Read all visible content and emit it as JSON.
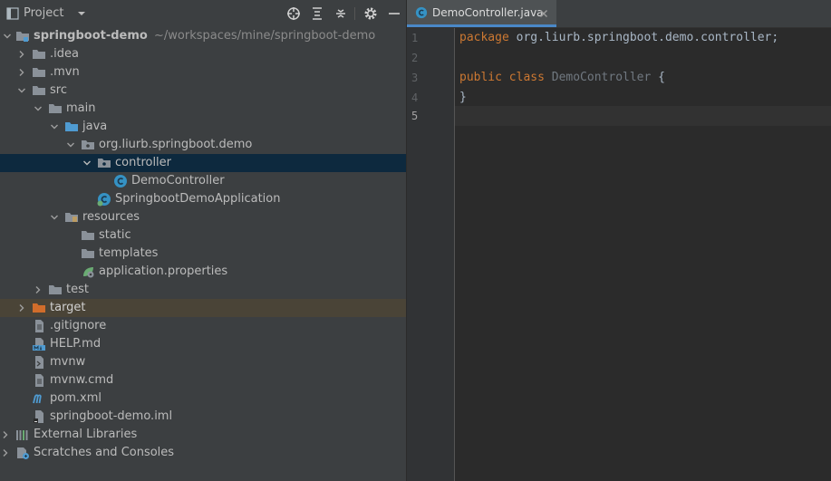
{
  "project_panel": {
    "title": "Project",
    "header_icons": [
      "locate-icon",
      "expand-all-icon",
      "collapse-all-icon",
      "gear-icon",
      "minimize-icon"
    ]
  },
  "tree": [
    {
      "label": "springboot-demo",
      "path": "~/workspaces/mine/springboot-demo",
      "icon": "module-folder-icon"
    },
    {
      "label": ".idea",
      "icon": "folder-icon"
    },
    {
      "label": ".mvn",
      "icon": "folder-icon"
    },
    {
      "label": "src",
      "icon": "folder-icon"
    },
    {
      "label": "main",
      "icon": "folder-icon"
    },
    {
      "label": "java",
      "icon": "source-folder-icon"
    },
    {
      "label": "org.liurb.springboot.demo",
      "icon": "package-icon"
    },
    {
      "label": "controller",
      "icon": "package-icon"
    },
    {
      "label": "DemoController",
      "icon": "class-icon"
    },
    {
      "label": "SpringbootDemoApplication",
      "icon": "spring-boot-class-icon"
    },
    {
      "label": "resources",
      "icon": "resources-folder-icon"
    },
    {
      "label": "static",
      "icon": "folder-icon"
    },
    {
      "label": "templates",
      "icon": "folder-icon"
    },
    {
      "label": "application.properties",
      "icon": "spring-properties-icon"
    },
    {
      "label": "test",
      "icon": "folder-icon"
    },
    {
      "label": "target",
      "icon": "excluded-folder-icon"
    },
    {
      "label": ".gitignore",
      "icon": "text-file-icon"
    },
    {
      "label": "HELP.md",
      "icon": "markdown-file-icon"
    },
    {
      "label": "mvnw",
      "icon": "shell-file-icon"
    },
    {
      "label": "mvnw.cmd",
      "icon": "text-file-icon"
    },
    {
      "label": "pom.xml",
      "icon": "maven-icon"
    },
    {
      "label": "springboot-demo.iml",
      "icon": "iml-file-icon"
    },
    {
      "label": "External Libraries",
      "icon": "libraries-icon"
    },
    {
      "label": "Scratches and Consoles",
      "icon": "scratches-icon"
    }
  ],
  "editor": {
    "tab_label": "DemoController.java",
    "line_numbers": [
      "1",
      "2",
      "3",
      "4",
      "5"
    ],
    "code": {
      "line1_kw": "package",
      "line1_rest": " org.liurb.springboot.demo.controller;",
      "line3_kw": "public class",
      "line3_cls": " DemoController",
      "line3_rest": " {",
      "line4": "}"
    }
  },
  "colors": {
    "panel_bg": "#3c3f41",
    "editor_bg": "#2b2b2b",
    "selection": "#0d293e",
    "keyword": "#cc7832",
    "folder": "#8a9199",
    "source_folder": "#4f9bd1",
    "excluded_folder": "#d16d2b",
    "class_icon": "#3592c4"
  }
}
